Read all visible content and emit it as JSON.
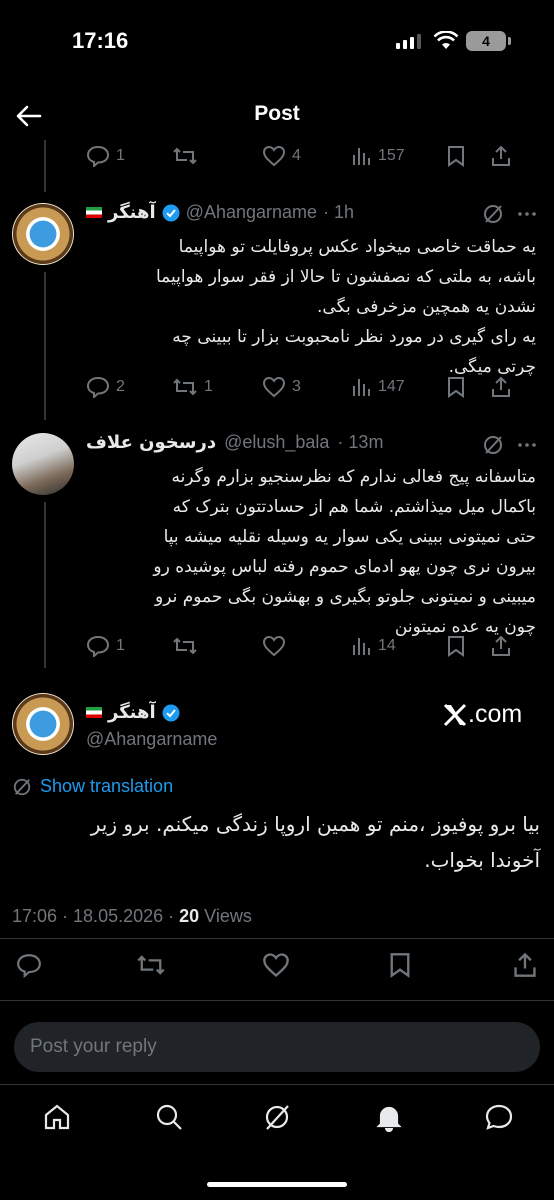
{
  "status": {
    "time": "17:16",
    "battery": "4"
  },
  "header": {
    "title": "Post"
  },
  "top_actions": {
    "replies": "1",
    "likes": "4",
    "views": "157"
  },
  "reply1": {
    "name": "آهنگر",
    "handle": "@Ahangarname",
    "time": "· 1h",
    "lines": [
      "یه حماقت خاصی میخواد عکس پروفایلت تو هواپیما",
      "باشه، به ملتی که نصفشون تا حالا از فقر سوار هواپیما",
      "نشدن یه همچین مزخرفی بگی.",
      "یه رای گیری در مورد نظر نامحبوبت بزار تا ببینی چه",
      "چرتی میگی."
    ],
    "replies": "2",
    "reposts": "1",
    "likes": "3",
    "views": "147"
  },
  "reply2": {
    "name": "درسخون علاف",
    "handle": "@elush_bala",
    "time": "· 13m",
    "lines": [
      "متاسفانه پیج فعالی ندارم که نظرسنجیو بزارم وگرنه",
      "باکمال میل میذاشتم. شما هم از حسادتتون بترک که",
      "حتی نمیتونی ببینی یکی سوار یه وسیله نقلیه میشه بپا",
      "بیرون نری چون یهو ادمای حموم رفته لباس پوشیده رو",
      "میبینی و نمیتونی جلوتو بگیری و بهشون بگی حموم نرو",
      "چون یه عده نمیتونن"
    ],
    "replies": "1",
    "views": "14"
  },
  "main": {
    "name": "آهنگر",
    "handle": "@Ahangarname",
    "brand": ".com",
    "show_translation": "Show translation",
    "lines": [
      "بیا برو پوفیوز ،منم تو همین اروپا زندگی میکنم. برو زیر",
      "آخوندا بخواب."
    ],
    "timestamp": "17:06 · 18.05.2026 · ",
    "views_count": "20",
    "views_label": " Views"
  },
  "reply_box": {
    "placeholder": "Post your reply"
  },
  "colors": {
    "accent": "#1d9bf0",
    "muted": "#71767b",
    "text": "#e7e9ea",
    "background": "#000000"
  },
  "icons": [
    "back-arrow-icon",
    "reply-icon",
    "repost-icon",
    "like-icon",
    "views-icon",
    "bookmark-icon",
    "share-icon",
    "grok-icon",
    "more-icon",
    "verified-icon",
    "home-icon",
    "search-icon",
    "grok-nav-icon",
    "notifications-icon",
    "messages-icon"
  ]
}
